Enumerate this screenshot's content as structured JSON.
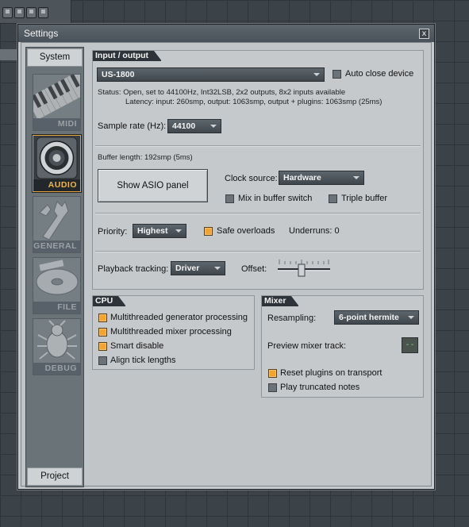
{
  "window": {
    "title": "Settings",
    "close_glyph": "x"
  },
  "nav": {
    "top_tab": "System",
    "bottom_tab": "Project",
    "items": [
      {
        "label": "MIDI",
        "icon": "piano-keys-icon",
        "active": false
      },
      {
        "label": "AUDIO",
        "icon": "speaker-icon",
        "active": true
      },
      {
        "label": "GENERAL",
        "icon": "wrench-icon",
        "active": false
      },
      {
        "label": "FILE",
        "icon": "disc-icon",
        "active": false
      },
      {
        "label": "DEBUG",
        "icon": "bug-icon",
        "active": false
      }
    ]
  },
  "io": {
    "header": "Input / output",
    "device": "US-1800",
    "auto_close_label": "Auto close device",
    "auto_close_checked": false,
    "status_line1": "Status: Open, set to 44100Hz, Int32LSB, 2x2 outputs, 8x2 inputs available",
    "status_line2": "Latency: input: 260smp, output: 1063smp, output + plugins: 1063smp (25ms)",
    "sample_rate_label": "Sample rate (Hz):",
    "sample_rate": "44100",
    "buffer_length": "Buffer length: 192smp (5ms)",
    "asio_button": "Show ASIO panel",
    "clock_source_label": "Clock source:",
    "clock_source": "Hardware",
    "mix_in_buffer_label": "Mix in buffer switch",
    "mix_in_buffer_checked": false,
    "triple_buffer_label": "Triple buffer",
    "triple_buffer_checked": false,
    "priority_label": "Priority:",
    "priority": "Highest",
    "safe_overloads_label": "Safe overloads",
    "safe_overloads_checked": true,
    "underruns": "Underruns: 0",
    "playback_tracking_label": "Playback tracking:",
    "playback_tracking": "Driver",
    "offset_label": "Offset:"
  },
  "cpu": {
    "header": "CPU",
    "options": [
      {
        "label": "Multithreaded generator processing",
        "checked": true
      },
      {
        "label": "Multithreaded mixer processing",
        "checked": true
      },
      {
        "label": "Smart disable",
        "checked": true
      },
      {
        "label": "Align tick lengths",
        "checked": false
      }
    ]
  },
  "mixer": {
    "header": "Mixer",
    "resampling_label": "Resampling:",
    "resampling": "6-point hermite",
    "preview_track_label": "Preview mixer track:",
    "preview_track_value": "--",
    "options": [
      {
        "label": "Reset plugins on transport",
        "checked": true
      },
      {
        "label": "Play truncated notes",
        "checked": false
      }
    ]
  },
  "colors": {
    "accent": "#f3a330",
    "panel_bg": "#c6c9cc",
    "header_bg": "#2d3338"
  }
}
